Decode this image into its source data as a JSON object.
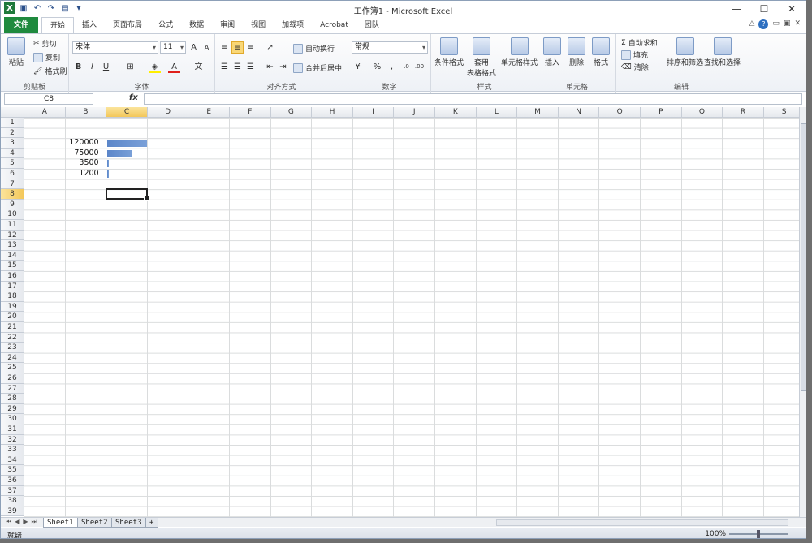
{
  "window": {
    "title": "工作簿1 - Microsoft Excel",
    "controls": [
      "—",
      "☐",
      "✕"
    ]
  },
  "qat": {
    "undo": "↶",
    "redo": "↷",
    "save": "💾"
  },
  "tabs": [
    "文件",
    "开始",
    "插入",
    "页面布局",
    "公式",
    "数据",
    "审阅",
    "视图",
    "加载项",
    "Acrobat",
    "团队"
  ],
  "ribbon": {
    "clipboard": {
      "paste": "粘贴",
      "cut": "剪切",
      "copy": "复制",
      "format_painter": "格式刷",
      "label": "剪贴板"
    },
    "font": {
      "name": "宋体",
      "size": "11",
      "bold": "B",
      "italic": "I",
      "underline": "U",
      "label": "字体"
    },
    "alignment": {
      "wrap": "自动换行",
      "merge": "合并后居中",
      "label": "对齐方式"
    },
    "number": {
      "format": "常规",
      "percent": "%",
      "comma": ",",
      "label": "数字"
    },
    "styles": {
      "conditional": "条件格式",
      "table_style_1": "套用",
      "table_style_2": "表格格式",
      "cell_style": "单元格样式",
      "label": "样式"
    },
    "cells": {
      "insert": "插入",
      "delete": "删除",
      "format": "格式",
      "label": "单元格"
    },
    "editing": {
      "autosum": "自动求和",
      "fill": "填充",
      "clear": "清除",
      "sort": "排序和筛选",
      "find": "查找和选择",
      "label": "编辑"
    }
  },
  "formula_bar": {
    "name_box": "C8",
    "fx": "fx",
    "value": ""
  },
  "columns": [
    "A",
    "B",
    "C",
    "D",
    "E",
    "F",
    "G",
    "H",
    "I",
    "J",
    "K",
    "L",
    "M",
    "N",
    "O",
    "P",
    "Q",
    "R",
    "S"
  ],
  "rows": [
    "1",
    "2",
    "3",
    "4",
    "5",
    "6",
    "7",
    "8",
    "9",
    "10",
    "11",
    "12",
    "13",
    "14",
    "15",
    "16",
    "17",
    "18",
    "19",
    "20",
    "21",
    "22",
    "23",
    "24",
    "25",
    "26",
    "27",
    "28",
    "29",
    "30",
    "31",
    "32",
    "33",
    "34",
    "35",
    "36",
    "37",
    "38",
    "39"
  ],
  "active_cell": {
    "col": "C",
    "row": "8"
  },
  "chart_data": {
    "type": "bar",
    "categories": [
      "B3",
      "B4",
      "B5",
      "B6"
    ],
    "values": [
      120000,
      75000,
      3500,
      1200
    ],
    "xlim": [
      0,
      120000
    ]
  },
  "sheets": [
    "Sheet1",
    "Sheet2",
    "Sheet3"
  ],
  "active_sheet": "Sheet1",
  "status": {
    "ready": "就绪",
    "zoom": "100%"
  }
}
